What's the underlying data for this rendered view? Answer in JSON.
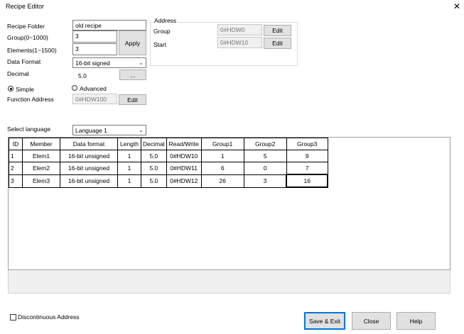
{
  "window": {
    "title": "Recipe Editor",
    "close_glyph": "✕"
  },
  "form": {
    "recipe_folder_label": "Recipe Folder",
    "recipe_folder_value": "old recipe",
    "group_label": "Group(0~1000)",
    "group_value": "3",
    "elements_label": "Elements(1~1500)",
    "elements_value": "3",
    "apply_label": "Apply",
    "data_format_label": "Data Format",
    "data_format_value": "16-bit signed",
    "decimal_label": "Decimal",
    "decimal_value": "5.0",
    "decimal_button": "...",
    "simple_label": "Simple",
    "advanced_label": "Advanced",
    "function_address_label": "Function Address",
    "function_address_value": "0#HDW100",
    "function_address_edit": "Edit"
  },
  "address": {
    "title": "Address",
    "group_label": "Group",
    "group_value": "0#HDW0",
    "group_edit": "Edit",
    "start_label": "Start",
    "start_value": "0#HDW10",
    "start_edit": "Edit"
  },
  "language": {
    "label": "Select language",
    "value": "Language 1"
  },
  "table": {
    "columns": [
      "ID",
      "Member",
      "Data format",
      "Length",
      "Decimal",
      "Read/Write",
      "Group1",
      "Group2",
      "Group3"
    ],
    "rows": [
      [
        "1",
        "Elem1",
        "16-bit unsigned",
        "1",
        "5.0",
        "0#HDW10",
        "1",
        "5",
        "9"
      ],
      [
        "2",
        "Elem2",
        "16-bit unsigned",
        "1",
        "5.0",
        "0#HDW11",
        "6",
        "0",
        "7"
      ],
      [
        "3",
        "Elem3",
        "16-bit unsigned",
        "1",
        "5.0",
        "0#HDW12",
        "26",
        "3",
        "16"
      ]
    ]
  },
  "footer": {
    "discontinuous_label": "Discontinuous Address",
    "save_exit": "Save & Exit",
    "close": "Close",
    "help": "Help"
  }
}
